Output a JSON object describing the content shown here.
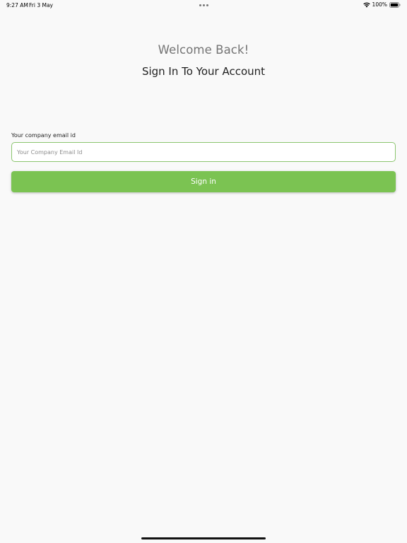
{
  "status_bar": {
    "time": "9:27 AM",
    "date": "Fri 3 May",
    "battery": "100%"
  },
  "heading": {
    "welcome": "Welcome Back!",
    "subtitle": "Sign In To Your Account"
  },
  "form": {
    "email_label": "Your company email id",
    "email_placeholder": "Your Company Email Id",
    "email_value": "",
    "signin_label": "Sign in"
  },
  "colors": {
    "accent": "#7bc352",
    "input_border": "#8cc56f",
    "background": "#f9f9f9"
  },
  "icons": [
    "more-dots-icon",
    "wifi-icon",
    "battery-icon"
  ]
}
